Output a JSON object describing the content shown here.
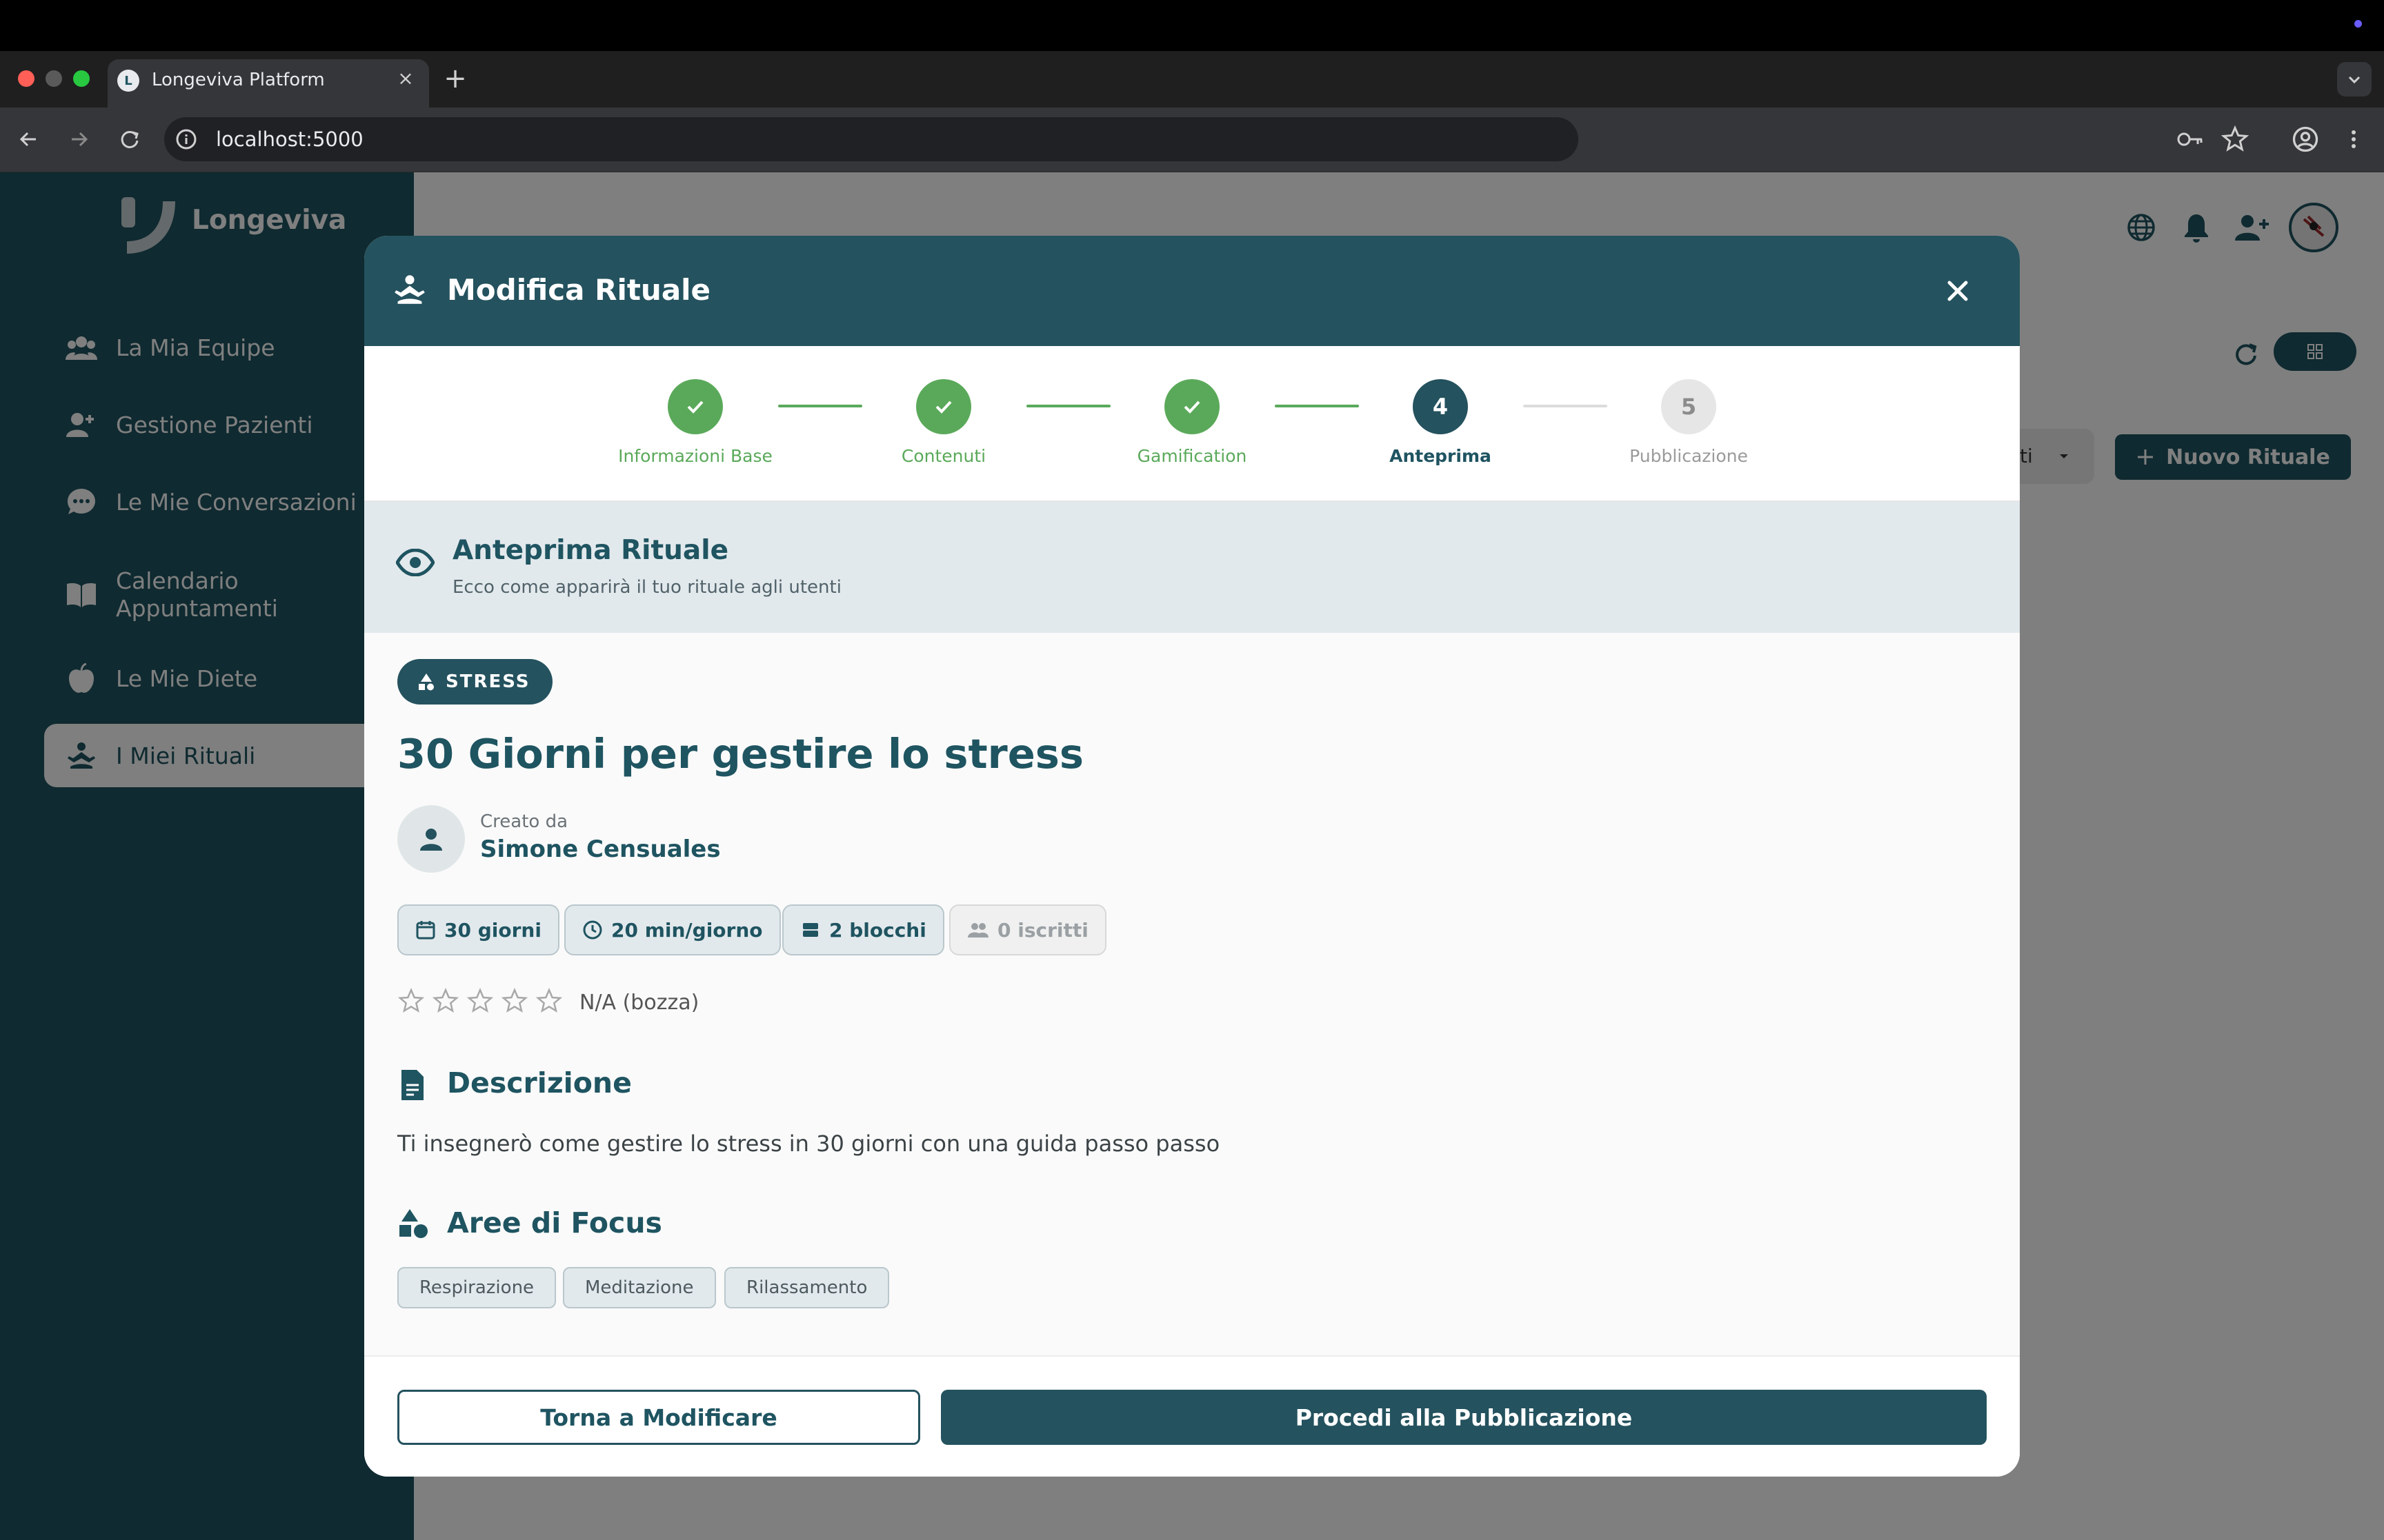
{
  "browser": {
    "tab_title": "Longeviva Platform",
    "tab_favicon": "L",
    "url": "localhost:5000"
  },
  "colors": {
    "primary": "#24525e",
    "sidebar": "#1f5461",
    "success": "#5aa95a",
    "muted": "#9aa0a3"
  },
  "app": {
    "brand": "Longeviva",
    "sidebar": {
      "items": [
        {
          "label": "La Mia Equipe",
          "icon": "team-icon"
        },
        {
          "label": "Gestione Pazienti",
          "icon": "person-add-icon"
        },
        {
          "label": "Le Mie Conversazioni",
          "icon": "chat-icon"
        },
        {
          "label": "Calendario Appuntamenti",
          "icon": "book-icon"
        },
        {
          "label": "Le Mie Diete",
          "icon": "apple-icon"
        },
        {
          "label": "I Miei Rituali",
          "icon": "meditation-icon",
          "active": true
        }
      ]
    },
    "header_icons": [
      "globe-icon",
      "bell-icon",
      "person-add-icon",
      "avatar"
    ],
    "filter_label": "ti",
    "new_ritual_label": "Nuovo Rituale"
  },
  "modal": {
    "title": "Modifica Rituale",
    "steps": [
      {
        "label": "Informazioni Base",
        "status": "done",
        "number": "1"
      },
      {
        "label": "Contenuti",
        "status": "done",
        "number": "2"
      },
      {
        "label": "Gamification",
        "status": "done",
        "number": "3"
      },
      {
        "label": "Anteprima",
        "status": "current",
        "number": "4"
      },
      {
        "label": "Pubblicazione",
        "status": "pending",
        "number": "5"
      }
    ],
    "preview_title": "Anteprima Rituale",
    "preview_subtitle": "Ecco come apparirà il tuo rituale agli utenti",
    "category_badge": "STRESS",
    "ritual_title": "30 Giorni per gestire lo stress",
    "creator_label": "Creato da",
    "creator_name": "Simone Censuales",
    "stats": {
      "duration": "30 giorni",
      "daily": "20 min/giorno",
      "blocks": "2 blocchi",
      "subscribers": "0 iscritti"
    },
    "rating": {
      "stars_filled": 0,
      "stars_total": 5,
      "text": "N/A (bozza)"
    },
    "description_heading": "Descrizione",
    "description_text": "Ti insegnerò come gestire lo stress in 30 giorni con una guida passo passo",
    "focus_heading": "Aree di Focus",
    "focus_areas": [
      "Respirazione",
      "Meditazione",
      "Rilassamento"
    ],
    "back_button": "Torna a Modificare",
    "next_button": "Procedi alla Pubblicazione"
  }
}
